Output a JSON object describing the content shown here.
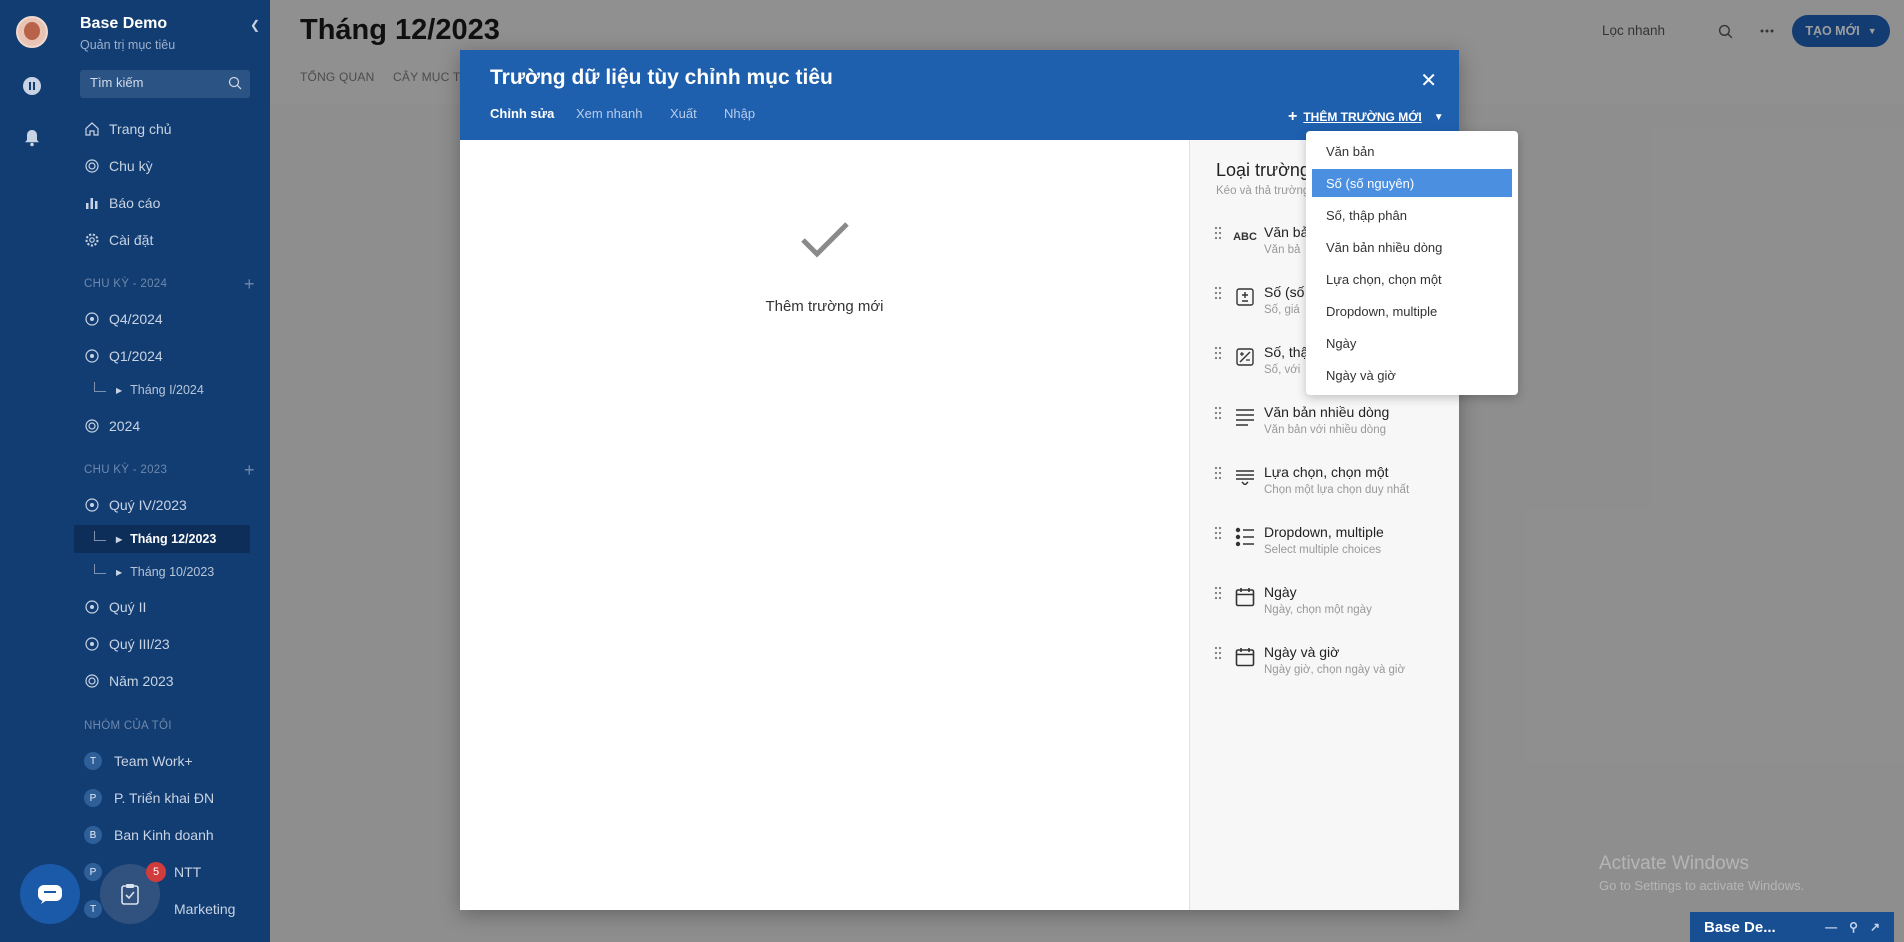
{
  "sidebar": {
    "app_name": "Base Demo",
    "app_sub": "Quản trị mục tiêu",
    "search_placeholder": "Tìm kiếm",
    "nav": [
      {
        "label": "Trang chủ",
        "icon": "home-icon"
      },
      {
        "label": "Chu kỳ",
        "icon": "cycle-icon"
      },
      {
        "label": "Báo cáo",
        "icon": "report-icon"
      },
      {
        "label": "Cài đặt",
        "icon": "gear-icon"
      }
    ],
    "section_2024": "CHU KỲ - 2024",
    "cycles_2024": [
      {
        "label": "Q4/2024"
      },
      {
        "label": "Q1/2024"
      }
    ],
    "sub_2024": "Tháng I/2024",
    "year_2024": "2024",
    "section_2023": "CHU KỲ - 2023",
    "cycle_q4_2023": "Quý IV/2023",
    "sub_2023": [
      {
        "label": "Tháng 12/2023",
        "active": true
      },
      {
        "label": "Tháng 10/2023",
        "active": false
      }
    ],
    "cycles_2023": [
      {
        "label": "Quý II"
      },
      {
        "label": "Quý III/23"
      },
      {
        "label": "Năm 2023"
      }
    ],
    "section_groups": "NHÓM CỦA TÔI",
    "groups": [
      {
        "initial": "T",
        "label": "Team Work+"
      },
      {
        "initial": "P",
        "label": "P. Triển khai ĐN"
      },
      {
        "initial": "B",
        "label": "Ban Kinh doanh"
      },
      {
        "initial": "P",
        "label": "NTT"
      },
      {
        "initial": "T",
        "label": "Marketing"
      }
    ],
    "task_badge": "5"
  },
  "header": {
    "title": "Tháng 12/2023",
    "tabs": [
      "TỔNG QUAN",
      "CÂY MỤC TI"
    ],
    "quick_filter": "Lọc nhanh",
    "new_button": "TẠO MỚI"
  },
  "modal": {
    "title": "Trường dữ liệu tùy chỉnh mục tiêu",
    "tabs": [
      {
        "label": "Chỉnh sửa",
        "active": true
      },
      {
        "label": "Xem nhanh",
        "active": false
      },
      {
        "label": "Xuất",
        "active": false
      },
      {
        "label": "Nhập",
        "active": false
      }
    ],
    "add_field_label": "THÊM TRƯỜNG MỚI",
    "empty_text": "Thêm trường mới",
    "palette_title": "Loại trường",
    "palette_sub": "Kéo và thả trường",
    "palette_items": [
      {
        "name": "Văn bả",
        "desc": "Văn bả",
        "icon": "abc-icon"
      },
      {
        "name": "Số (số",
        "desc": "Số, giá",
        "icon": "number-icon"
      },
      {
        "name": "Số, thậ",
        "desc": "Số, với",
        "icon": "percent-icon"
      },
      {
        "name": "Văn bản nhiều dòng",
        "desc": "Văn bản với nhiều dòng",
        "icon": "multiline-text-icon"
      },
      {
        "name": "Lựa chọn, chọn một",
        "desc": "Chọn một lựa chọn duy nhất",
        "icon": "single-choice-icon"
      },
      {
        "name": "Dropdown, multiple",
        "desc": "Select multiple choices",
        "icon": "list-icon"
      },
      {
        "name": "Ngày",
        "desc": "Ngày, chọn một ngày",
        "icon": "calendar-icon"
      },
      {
        "name": "Ngày và giờ",
        "desc": "Ngày giờ, chọn ngày và giờ",
        "icon": "calendar-time-icon"
      }
    ]
  },
  "dropdown": {
    "items": [
      {
        "label": "Văn bản",
        "highlighted": false
      },
      {
        "label": "Số (số nguyên)",
        "highlighted": true
      },
      {
        "label": "Số, thập phân",
        "highlighted": false
      },
      {
        "label": "Văn bản nhiều dòng",
        "highlighted": false
      },
      {
        "label": "Lựa chọn, chọn một",
        "highlighted": false
      },
      {
        "label": "Dropdown, multiple",
        "highlighted": false
      },
      {
        "label": "Ngày",
        "highlighted": false
      },
      {
        "label": "Ngày và giờ",
        "highlighted": false
      }
    ]
  },
  "system": {
    "watermark_title": "Activate Windows",
    "watermark_sub": "Go to Settings to activate Windows.",
    "chat_dock_label": "Base De..."
  },
  "colors": {
    "sidebar": "#123d72",
    "modal_header": "#1e5fae",
    "highlight": "#4a8fe0",
    "accent": "#1f61b8"
  }
}
